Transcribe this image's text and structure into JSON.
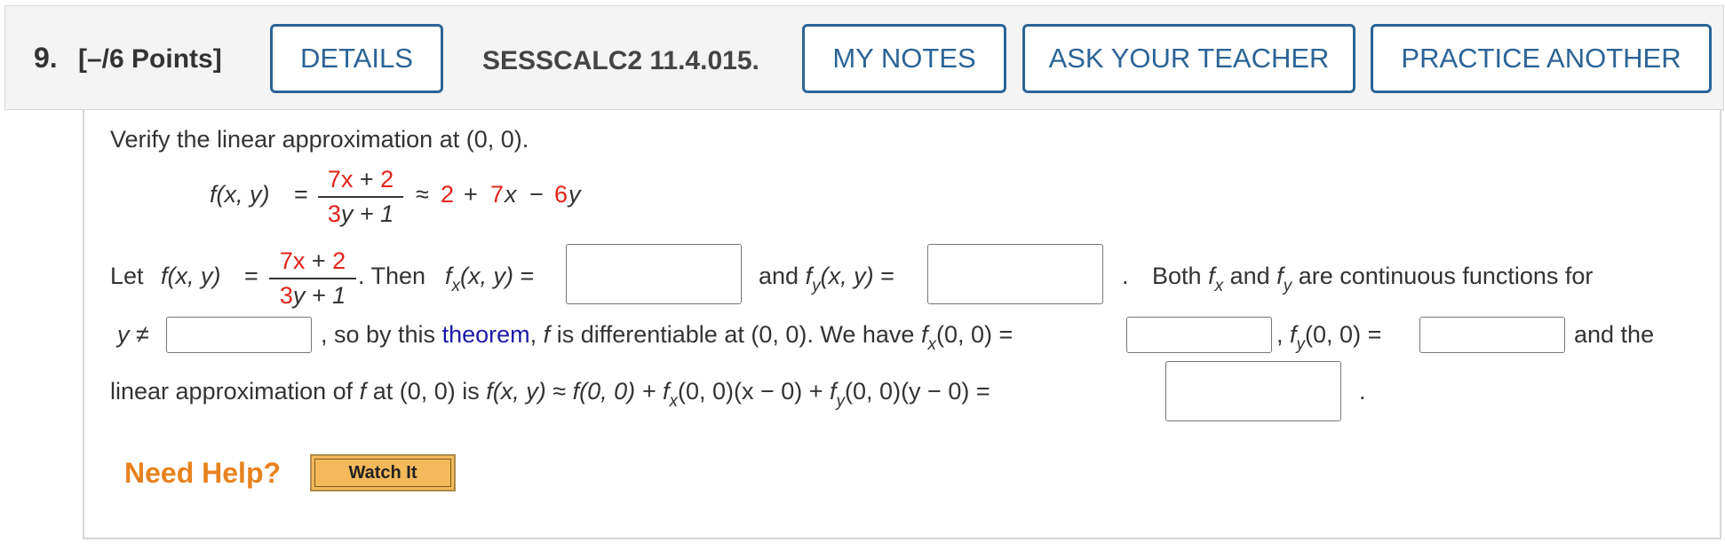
{
  "header": {
    "question_number": "9.",
    "points": "[–/6 Points]",
    "details_button": "DETAILS",
    "assignment_id": "SESSCALC2 11.4.015.",
    "my_notes_button": "MY NOTES",
    "ask_teacher_button": "ASK YOUR TEACHER",
    "practice_button": "PRACTICE ANOTHER"
  },
  "question": {
    "intro": "Verify the linear approximation at (0, 0).",
    "fdef": "f(x, y)",
    "eq": "=",
    "num_a": "7x",
    "num_plus": " + ",
    "num_b": "2",
    "den_a": "3",
    "den_b": "y + 1",
    "approx": "≈",
    "r1": "2",
    "plus": "+",
    "r2": "7",
    "x": "x",
    "minus": "−",
    "r3": "6",
    "y": "y",
    "let": "Let",
    "then": ". Then",
    "fx": "f",
    "fx_sub": "x",
    "args": "(x, y)",
    "and_text": "and",
    "fy_sub": "y",
    "period": ".",
    "both_text": "Both",
    "are_continuous": "are continuous functions for",
    "y_neq": "y ≠",
    "so_by": ", so by this",
    "theorem_link": "theorem",
    "diff_text": "is differentiable at (0, 0). We have",
    "at00": "(0, 0) =",
    "comma": ",",
    "and_the": "and the",
    "linear_text": "linear approximation of",
    "at00is": "at (0, 0) is",
    "approx_expr1": "f(0, 0) +",
    "approx_expr2": "(0, 0)(x − 0) +",
    "approx_expr3": "(0, 0)(y − 0) ="
  },
  "help": {
    "need_help": "Need Help?",
    "watch_it": "Watch It"
  },
  "colors": {
    "accent": "#2b6496",
    "red": "#e2231a",
    "link": "#1a1aa6",
    "help_orange": "#e8821e"
  }
}
